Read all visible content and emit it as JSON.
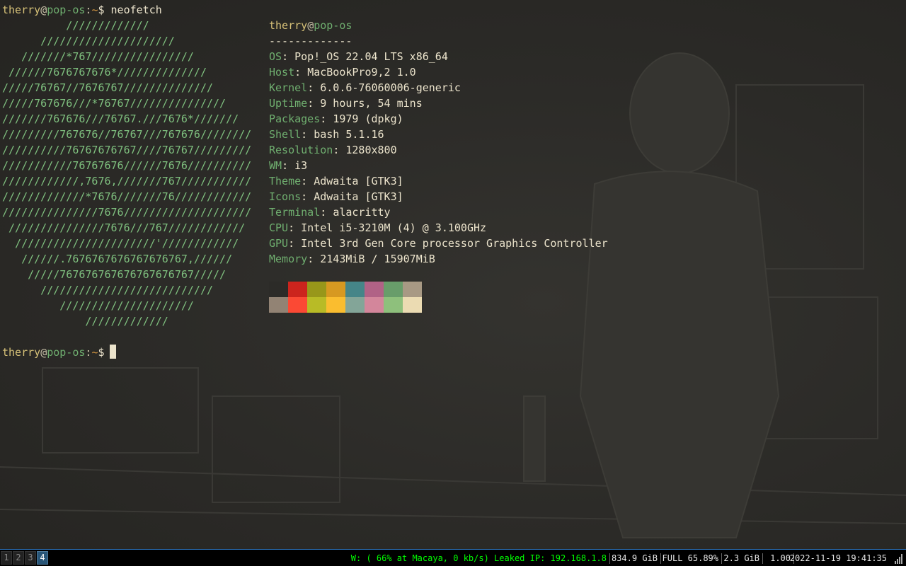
{
  "prompt": {
    "user": "therry",
    "at": "@",
    "host": "pop-os",
    "colon": ":",
    "path": "~",
    "dollar": "$",
    "command": "neofetch"
  },
  "logo_lines": [
    "          /////////////",
    "      /////////////////////",
    "   ///////*767////////////////",
    " //////7676767676*//////////////",
    "/////76767//7676767//////////////",
    "/////767676///*76767///////////////",
    "///////767676///76767.///7676*///////",
    "/////////767676//76767///767676////////",
    "//////////76767676767////76767/////////",
    "///////////76767676//////7676//////////",
    "////////////,7676,///////767///////////",
    "/////////////*7676///////76////////////",
    "///////////////7676////////////////////",
    " ///////////////7676///767////////////",
    "  //////////////////////'////////////",
    "   //////.7676767676767676767,//////",
    "    /////767676767676767676767/////",
    "      ///////////////////////////",
    "         /////////////////////",
    "             /////////////"
  ],
  "info": {
    "header_user": "therry",
    "header_at": "@",
    "header_host": "pop-os",
    "separator": "-------------",
    "rows": [
      {
        "key": "OS",
        "val": "Pop!_OS 22.04 LTS x86_64"
      },
      {
        "key": "Host",
        "val": "MacBookPro9,2 1.0"
      },
      {
        "key": "Kernel",
        "val": "6.0.6-76060006-generic"
      },
      {
        "key": "Uptime",
        "val": "9 hours, 54 mins"
      },
      {
        "key": "Packages",
        "val": "1979 (dpkg)"
      },
      {
        "key": "Shell",
        "val": "bash 5.1.16"
      },
      {
        "key": "Resolution",
        "val": "1280x800"
      },
      {
        "key": "WM",
        "val": "i3"
      },
      {
        "key": "Theme",
        "val": "Adwaita [GTK3]"
      },
      {
        "key": "Icons",
        "val": "Adwaita [GTK3]"
      },
      {
        "key": "Terminal",
        "val": "alacritty"
      },
      {
        "key": "CPU",
        "val": "Intel i5-3210M (4) @ 3.100GHz"
      },
      {
        "key": "GPU",
        "val": "Intel 3rd Gen Core processor Graphics Controller"
      },
      {
        "key": "Memory",
        "val": "2143MiB / 15907MiB"
      }
    ],
    "colors_row1": [
      "#2c2b28",
      "#cc241d",
      "#98971a",
      "#d79921",
      "#458588",
      "#b16286",
      "#689d6a",
      "#a89984"
    ],
    "colors_row2": [
      "#928374",
      "#fb4934",
      "#b8bb26",
      "#fabd2f",
      "#83a598",
      "#d3869b",
      "#8ec07c",
      "#ebdbb2"
    ]
  },
  "workspaces": [
    {
      "label": "1",
      "active": false
    },
    {
      "label": "2",
      "active": false
    },
    {
      "label": "3",
      "active": false
    },
    {
      "label": "4",
      "active": true
    }
  ],
  "status": {
    "wireless": "W: ( 66% at Macaya, 0 kb/s) Leaked IP: 192.168.1.8",
    "disk": "834.9 GiB",
    "battery": "FULL 65.89%",
    "memory": "2.3 GiB",
    "load": "1.00",
    "datetime": "2022-11-19 19:41:35",
    "accent_green": "#00ff00"
  }
}
